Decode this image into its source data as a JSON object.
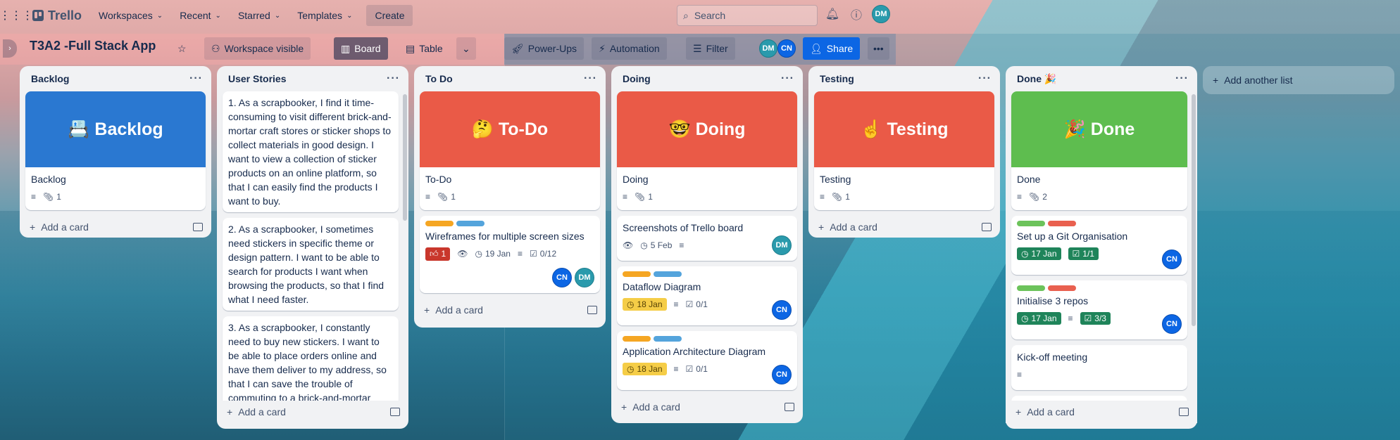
{
  "topnav": {
    "logo": "Trello",
    "menus": [
      "Workspaces",
      "Recent",
      "Starred",
      "Templates"
    ],
    "create": "Create",
    "search_placeholder": "Search",
    "user_initials": "DM"
  },
  "board": {
    "title": "T3A2 -Full Stack App",
    "visibility": "Workspace visible",
    "views": {
      "board": "Board",
      "table": "Table"
    },
    "powerups": "Power-Ups",
    "automation": "Automation",
    "filter": "Filter",
    "members": [
      "DM",
      "CN"
    ],
    "share": "Share"
  },
  "colors": {
    "blue": "#2a78d1",
    "red": "#ea5a47",
    "green": "#5ebd4f",
    "label_yellow": "#f5a623",
    "label_blue": "#54a4dc",
    "label_green": "#6cc35b",
    "label_red": "#e9604f"
  },
  "lists": {
    "backlog": {
      "title": "Backlog",
      "cover": "📇 Backlog",
      "card_title": "Backlog",
      "attachments": "1",
      "add": "Add a card"
    },
    "stories": {
      "title": "User Stories",
      "s1": "1. As a scrapbooker, I find it time-consuming to visit different brick-and-mortar craft stores or sticker shops to collect materials in good design. I want to view a collection of sticker products on an online platform, so that I can easily find the products I want to buy.",
      "s2": "2. As a scrapbooker, I sometimes need stickers in specific theme or design pattern. I want to be able to search for products I want when browsing the products, so that I find what I need faster.",
      "s3": "3. As a scrapbooker, I constantly need to buy new stickers. I want to be able to place orders online and have them deliver to my address, so that I can save the trouble of commuting to a brick-and-mortar",
      "add": "Add a card"
    },
    "todo": {
      "title": "To Do",
      "cover": "🤔 To-Do",
      "card_title": "To-Do",
      "attachments": "1",
      "wf_title": "Wireframes for multiple screen sizes",
      "wf_votes": "1",
      "wf_date": "19 Jan",
      "wf_check": "0/12",
      "add": "Add a card"
    },
    "doing": {
      "title": "Doing",
      "cover": "🤓 Doing",
      "card_title": "Doing",
      "attachments": "1",
      "c1_title": "Screenshots of Trello board",
      "c1_date": "5 Feb",
      "c2_title": "Dataflow Diagram",
      "c2_date": "18 Jan",
      "c2_check": "0/1",
      "c3_title": "Application Architecture Diagram",
      "c3_date": "18 Jan",
      "c3_check": "0/1",
      "add": "Add a card"
    },
    "testing": {
      "title": "Testing",
      "cover": "☝️ Testing",
      "card_title": "Testing",
      "attachments": "1",
      "add": "Add a card"
    },
    "done": {
      "title": "Done 🎉",
      "cover": "🎉 Done",
      "card_title": "Done",
      "attachments": "2",
      "c1_title": "Set up a Git Organisation",
      "c1_date": "17 Jan",
      "c1_check": "1/1",
      "c2_title": "Initialise 3 repos",
      "c2_date": "17 Jan",
      "c2_check": "3/3",
      "c3_title": "Kick-off meeting",
      "add": "Add a card"
    }
  },
  "add_list": "Add another list"
}
